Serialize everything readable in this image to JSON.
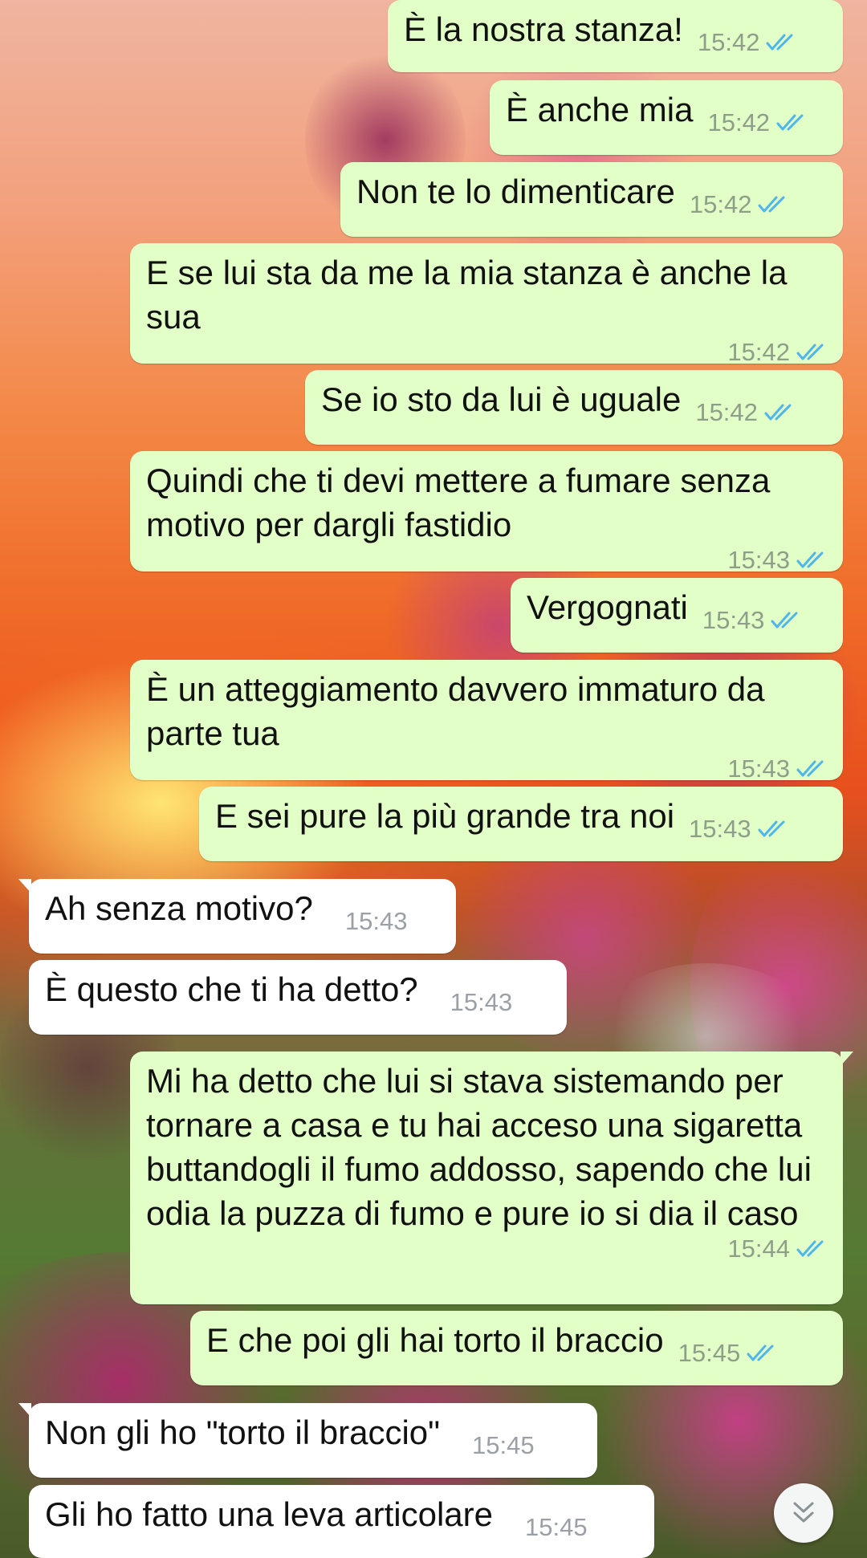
{
  "conversation": {
    "messages": [
      {
        "dir": "out",
        "text": "È la nostra stanza!",
        "time": "15:42",
        "status": "read"
      },
      {
        "dir": "out",
        "text": "È anche mia",
        "time": "15:42",
        "status": "read"
      },
      {
        "dir": "out",
        "text": "Non te lo dimenticare",
        "time": "15:42",
        "status": "read"
      },
      {
        "dir": "out",
        "text": "E se lui sta da me la mia stanza è anche la sua",
        "time": "15:42",
        "status": "read"
      },
      {
        "dir": "out",
        "text": "Se io sto da lui è uguale",
        "time": "15:42",
        "status": "read"
      },
      {
        "dir": "out",
        "text": "Quindi che ti devi mettere a fumare senza motivo per dargli fastidio",
        "time": "15:43",
        "status": "read"
      },
      {
        "dir": "out",
        "text": "Vergognati",
        "time": "15:43",
        "status": "read"
      },
      {
        "dir": "out",
        "text": "È un atteggiamento davvero immaturo da parte tua",
        "time": "15:43",
        "status": "read"
      },
      {
        "dir": "out",
        "text": "E sei pure la più grande tra noi",
        "time": "15:43",
        "status": "read"
      },
      {
        "dir": "in",
        "text": "Ah senza motivo?",
        "time": "15:43"
      },
      {
        "dir": "in",
        "text": "È questo che ti ha detto?",
        "time": "15:43"
      },
      {
        "dir": "out",
        "text": "Mi ha detto che lui si stava sistemando per tornare a casa e tu hai acceso una sigaretta buttandogli il fumo addosso, sapendo che lui odia la puzza di fumo e pure io si dia il caso",
        "time": "15:44",
        "status": "read"
      },
      {
        "dir": "out",
        "text": "E che poi gli hai torto il braccio",
        "time": "15:45",
        "status": "read"
      },
      {
        "dir": "in",
        "text": "Non gli ho \"torto il braccio\"",
        "time": "15:45"
      },
      {
        "dir": "in",
        "text": "Gli ho fatto una leva articolare",
        "time": "15:45"
      }
    ]
  },
  "colors": {
    "outgoing_bubble": "#e1ffc7",
    "incoming_bubble": "#ffffff",
    "read_ticks": "#4fb6ec",
    "timestamp": "#8e9e89"
  },
  "icons": {
    "read_receipt": "double-check-icon",
    "scroll_down": "double-chevron-down-icon"
  }
}
